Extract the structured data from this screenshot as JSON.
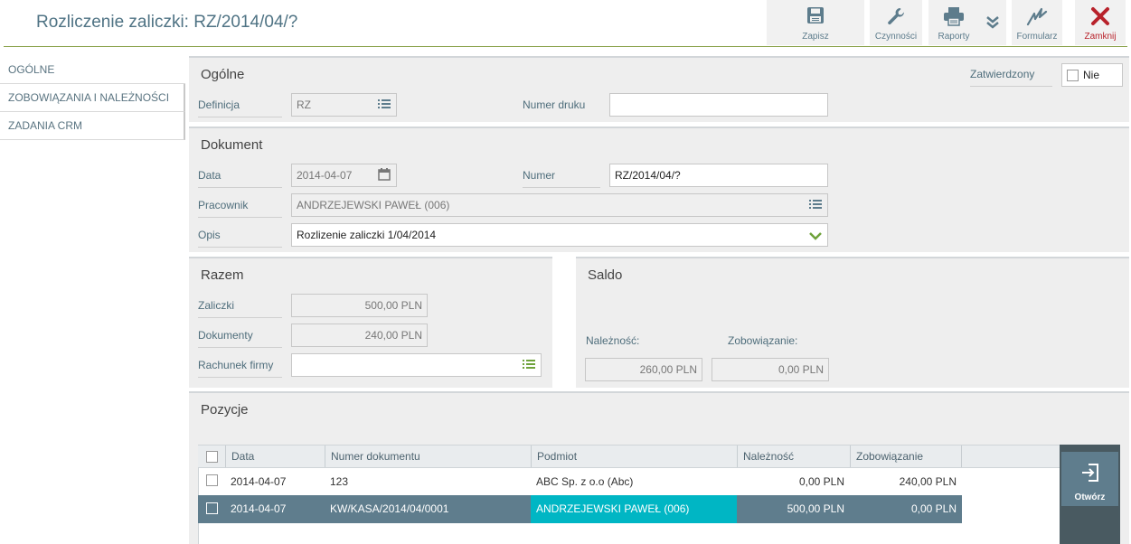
{
  "header": {
    "title": "Rozliczenie zaliczki: RZ/2014/04/?",
    "toolbar": {
      "save": "Zapisz",
      "actions": "Czynności",
      "reports": "Raporty",
      "form": "Formularz",
      "close": "Zamknij"
    }
  },
  "sidebar": {
    "items": [
      {
        "label": "OGÓLNE"
      },
      {
        "label": "ZOBOWIĄZANIA I NALEŻNOŚCI"
      },
      {
        "label": "ZADANIA CRM"
      }
    ]
  },
  "general": {
    "title": "Ogólne",
    "definition_label": "Definicja",
    "definition_value": "RZ",
    "print_number_label": "Numer druku",
    "print_number_value": "",
    "approved_label": "Zatwierdzony",
    "approved_value": "Nie"
  },
  "document": {
    "title": "Dokument",
    "date_label": "Data",
    "date_value": "2014-04-07",
    "number_label": "Numer",
    "number_value": "RZ/2014/04/?",
    "employee_label": "Pracownik",
    "employee_value": "ANDRZEJEWSKI PAWEŁ (006)",
    "description_label": "Opis",
    "description_value": "Rozlizenie zaliczki 1/04/2014"
  },
  "totals": {
    "title": "Razem",
    "advances_label": "Zaliczki",
    "advances_value": "500,00 PLN",
    "documents_label": "Dokumenty",
    "documents_value": "240,00 PLN",
    "account_label": "Rachunek firmy",
    "account_value": ""
  },
  "balance": {
    "title": "Saldo",
    "receivable_label": "Należność:",
    "receivable_value": "260,00 PLN",
    "liability_label": "Zobowiązanie:",
    "liability_value": "0,00 PLN"
  },
  "positions": {
    "title": "Pozycje",
    "columns": [
      "Data",
      "Numer dokumentu",
      "Podmiot",
      "Należność",
      "Zobowiązanie"
    ],
    "rows": [
      {
        "date": "2014-04-07",
        "number": "123",
        "entity": "ABC Sp. z o.o (Abc)",
        "receivable": "0,00 PLN",
        "liability": "240,00 PLN"
      },
      {
        "date": "2014-04-07",
        "number": "KW/KASA/2014/04/0001",
        "entity": "ANDRZEJEWSKI PAWEŁ (006)",
        "receivable": "500,00 PLN",
        "liability": "0,00 PLN"
      }
    ],
    "open_label": "Otwórz"
  },
  "colors": {
    "accent": "#4f7384",
    "header_rule": "#8aa24a",
    "selected_row": "#5f7d8d",
    "selected_cell": "#00b6c4",
    "close_red": "#b8222b",
    "valid_green": "#6ea23a"
  }
}
